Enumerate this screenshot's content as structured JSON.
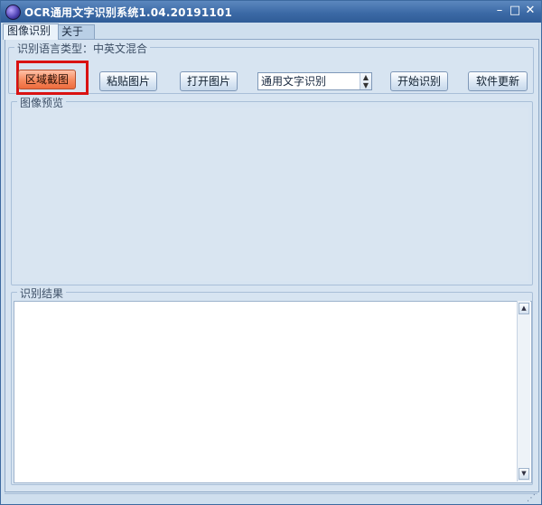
{
  "window": {
    "title": "OCR通用文字识别系统1.04.20191101",
    "controls": {
      "minimize": "–",
      "maximize": "□",
      "close": "✕"
    }
  },
  "tabs": [
    {
      "label": "图像识别",
      "active": true
    },
    {
      "label": "关于",
      "active": false
    }
  ],
  "toolbar_group": {
    "label": "识别语言类型：中英文混合",
    "region_capture_label": "区域截图",
    "paste_image_label": "粘贴图片",
    "open_image_label": "打开图片",
    "mode_select": {
      "value": "通用文字识别",
      "arrow_up": "▲",
      "arrow_down": "▼"
    },
    "start_label": "开始识别",
    "update_label": "软件更新"
  },
  "preview_group": {
    "label": "图像预览"
  },
  "result_group": {
    "label": "识别结果",
    "text": "",
    "scroll_up": "▲",
    "scroll_down": "▼"
  },
  "statusbar": {
    "grip": "⋰"
  },
  "colors": {
    "accent_button": "#f7895e",
    "highlight_border": "#d91212",
    "titlebar": "#3c6aa6"
  }
}
